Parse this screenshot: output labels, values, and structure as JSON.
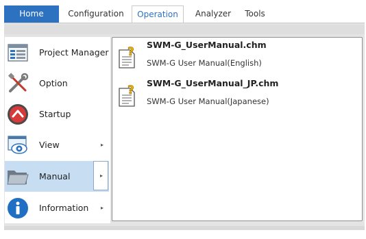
{
  "tabs": [
    {
      "label": "Home"
    },
    {
      "label": "Configuration"
    },
    {
      "label": "Operation"
    },
    {
      "label": "Analyzer"
    },
    {
      "label": "Tools"
    }
  ],
  "active_tab": "Operation",
  "menu": {
    "items": [
      {
        "label": "Project Manager",
        "icon": "project-manager-icon",
        "has_submenu": false
      },
      {
        "label": "Option",
        "icon": "tools-icon",
        "has_submenu": false
      },
      {
        "label": "Startup",
        "icon": "startup-icon",
        "has_submenu": false
      },
      {
        "label": "View",
        "icon": "view-icon",
        "has_submenu": true,
        "arrow": "▸"
      },
      {
        "label": "Manual",
        "icon": "folder-icon",
        "has_submenu": true,
        "arrow": "▸",
        "selected": true
      },
      {
        "label": "Information",
        "icon": "info-icon",
        "has_submenu": true,
        "arrow": "▸"
      }
    ]
  },
  "manual_files": [
    {
      "name": "SWM-G_UserManual.chm",
      "description": "SWM-G User Manual(English)",
      "icon": "help-file-icon"
    },
    {
      "name": "SWM-G_UserManual_JP.chm",
      "description": "SWM-G User Manual(Japanese)",
      "icon": "help-file-icon"
    }
  ],
  "colors": {
    "accent": "#2c72c0",
    "selected_bg": "#c7def2",
    "frame": "#e4e4e4"
  }
}
